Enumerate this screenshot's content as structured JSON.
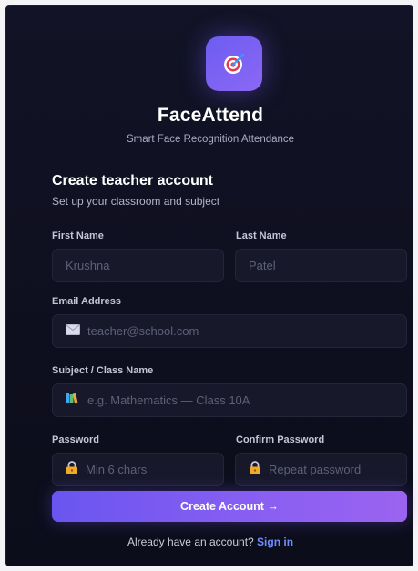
{
  "brand": {
    "name": "FaceAttend",
    "tagline": "Smart Face Recognition Attendance",
    "logo_icon": "target-dart-icon",
    "accent_color": "#7b5cf3"
  },
  "form": {
    "heading": "Create teacher account",
    "subheading": "Set up your classroom and subject",
    "first_name": {
      "label": "First Name",
      "placeholder": "Krushna",
      "value": ""
    },
    "last_name": {
      "label": "Last Name",
      "placeholder": "Patel",
      "value": ""
    },
    "email": {
      "label": "Email Address",
      "placeholder": "teacher@school.com",
      "value": "",
      "icon": "envelope-icon"
    },
    "subject": {
      "label": "Subject / Class Name",
      "placeholder": "e.g. Mathematics — Class 10A",
      "value": "",
      "icon": "books-icon"
    },
    "password": {
      "label": "Password",
      "placeholder": "Min 6 chars",
      "value": "",
      "icon": "lock-icon"
    },
    "confirm_password": {
      "label": "Confirm Password",
      "placeholder": "Repeat password",
      "value": "",
      "icon": "lock-icon"
    },
    "submit_label": "Create Account →"
  },
  "footer": {
    "prompt": "Already have an account?",
    "link_label": "Sign in"
  }
}
